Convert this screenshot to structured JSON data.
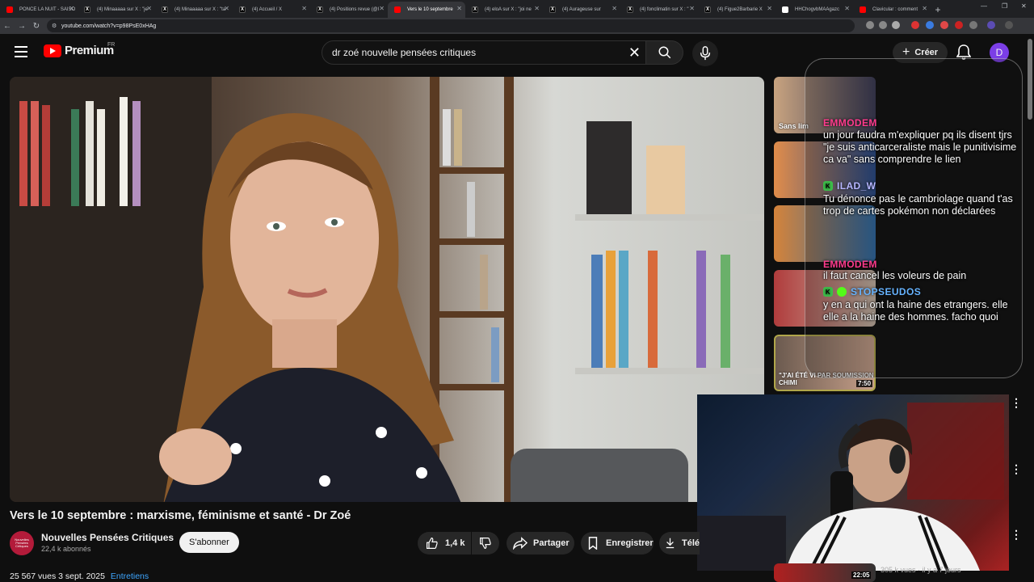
{
  "browser": {
    "tabs": [
      {
        "label": "PONCE LA NUIT - SAISO",
        "favicon": "youtube",
        "active": false
      },
      {
        "label": "(4) Minaaaaa sur X : \"je",
        "favicon": "x",
        "active": false
      },
      {
        "label": "(4) Minaaaaa sur X : \"ta",
        "favicon": "x",
        "active": false
      },
      {
        "label": "(4) Accueil / X",
        "favicon": "x",
        "active": false
      },
      {
        "label": "(4) Positions revue (@l",
        "favicon": "x",
        "active": false
      },
      {
        "label": "Vers le 10 septembre",
        "favicon": "youtube",
        "active": true
      },
      {
        "label": "(4) eloA sur X : \"joi ne",
        "favicon": "x",
        "active": false
      },
      {
        "label": "(4) Aurageuse sur",
        "favicon": "x",
        "active": false
      },
      {
        "label": "(4) fonclimatin sur X : \"",
        "favicon": "x",
        "active": false
      },
      {
        "label": "(4) Figue2Barbarie X",
        "favicon": "x",
        "active": false
      },
      {
        "label": "HHChogvbMAAgazc",
        "favicon": "image",
        "active": false
      },
      {
        "label": "Clavicular : comment",
        "favicon": "youtube",
        "active": false
      }
    ],
    "url": "youtube.com/watch?v=p98PsE0xHAg"
  },
  "header": {
    "logo_text": "Premium",
    "country": "FR",
    "search_value": "dr zoé nouvelle pensées critiques",
    "create_label": "Créer",
    "avatar_letter": "D"
  },
  "chat": {
    "messages": [
      {
        "user": "EMMODEM",
        "color": "#ff3b8d",
        "badge": "none",
        "text": "un jour faudra m'expliquer pq ils disent tjrs \"je suis anticarceraliste mais le punitivisime ca va\" sans comprendre le lien"
      },
      {
        "user": "ILAD_W",
        "color": "#b6b6ff",
        "badge": "k",
        "text": "Tu dénonce pas le cambriolage quand t'as trop de cartes pokémon non déclarées"
      },
      {
        "user": "EMMODEM",
        "color": "#ff3b8d",
        "badge": "none",
        "text": "il faut cancel les voleurs de pain"
      },
      {
        "user": "STOPSEUDOS",
        "color": "#66b3ff",
        "badge": "k2",
        "text": "y en a qui ont la haine des etrangers. elle elle a la haine des hommes. facho quoi"
      }
    ]
  },
  "sidebar": {
    "thumbnails": [
      {
        "label": "Sans lim"
      },
      {
        "label": ""
      },
      {
        "label": ""
      },
      {
        "label": ""
      },
      {
        "label": "\"J'AI ÉTÉ VI PAR SOUMISSION CHIMI",
        "duration": "7:50"
      }
    ],
    "bottom_meta": "305 k vues · il y a 7 jours",
    "bottom_duration": "22:05"
  },
  "video": {
    "title": "Vers le 10 septembre : marxisme, féminisme et santé - Dr Zoé",
    "channel": "Nouvelles Pensées Critiques",
    "channel_avatar_text": "Nouvelles Pensées Critiques",
    "subscribers": "22,4 k abonnés",
    "subscribe_label": "S'abonner",
    "likes": "1,4 k",
    "share_label": "Partager",
    "save_label": "Enregistrer",
    "download_label": "Télé",
    "views": "25 567 vues",
    "date": "3 sept. 2025",
    "tag": "Entretiens"
  },
  "colors": {
    "bg": "#0f0f0f",
    "accent_red": "#ff0000",
    "link_blue": "#3ea6ff"
  }
}
